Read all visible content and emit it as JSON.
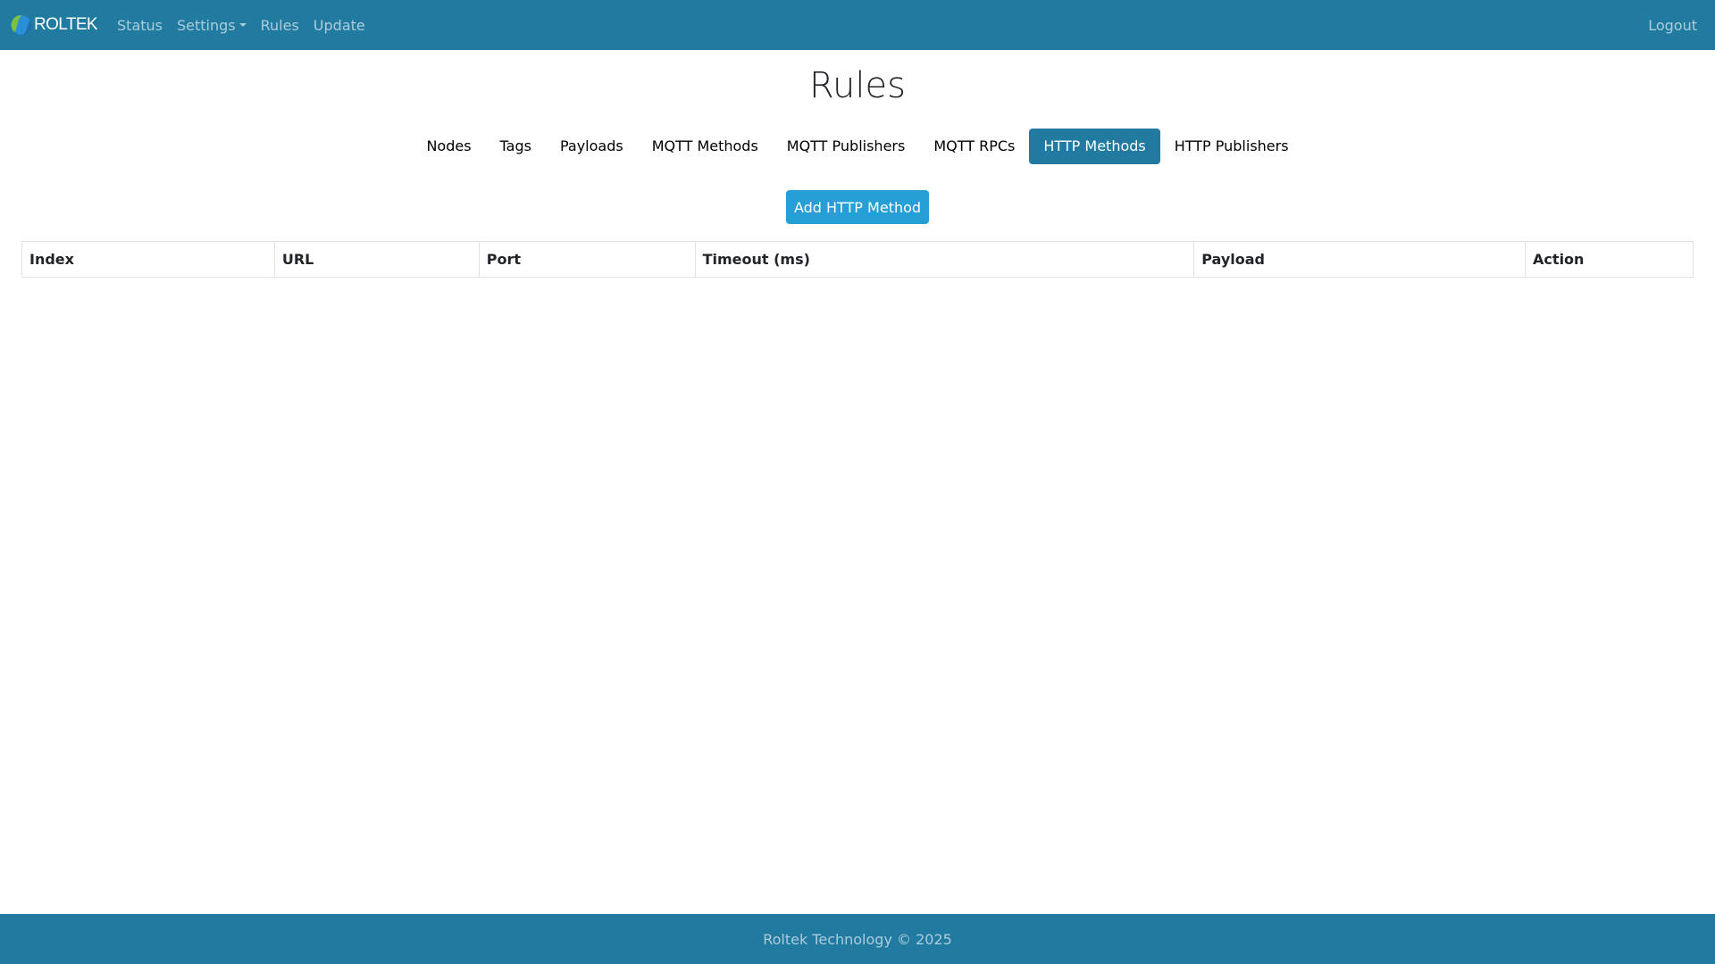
{
  "navbar": {
    "brand": "ROLTEK",
    "items": [
      {
        "label": "Status"
      },
      {
        "label": "Settings"
      },
      {
        "label": "Rules"
      },
      {
        "label": "Update"
      }
    ],
    "logout": "Logout"
  },
  "page": {
    "title": "Rules"
  },
  "tabs": [
    {
      "label": "Nodes"
    },
    {
      "label": "Tags"
    },
    {
      "label": "Payloads"
    },
    {
      "label": "MQTT Methods"
    },
    {
      "label": "MQTT Publishers"
    },
    {
      "label": "MQTT RPCs"
    },
    {
      "label": "HTTP Methods",
      "active": true
    },
    {
      "label": "HTTP Publishers"
    }
  ],
  "actions": {
    "add_label": "Add HTTP Method"
  },
  "table": {
    "columns": [
      "Index",
      "URL",
      "Port",
      "Timeout (ms)",
      "Payload",
      "Action"
    ],
    "rows": []
  },
  "footer": {
    "text": "Roltek Technology © 2025"
  },
  "colors": {
    "navbar": "#217aa0",
    "active_tab": "#217aa0",
    "primary_button": "#259fd6"
  }
}
